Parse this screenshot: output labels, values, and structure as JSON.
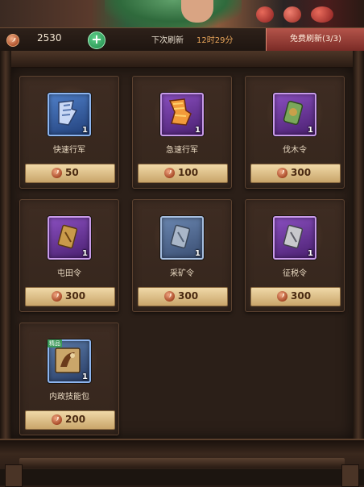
{
  "header": {
    "currency_value": "2530",
    "add_label": "+",
    "refresh_label": "下次刷新",
    "refresh_time": "12时29分",
    "free_refresh_label": "免费刷新(3/3)"
  },
  "colors": {
    "accent_gold": "#e9a65b",
    "price_bar": "#e2c48d",
    "rare_blue": "#4f7fc8",
    "epic_purple": "#8a4fc0",
    "free_button": "#b4544a"
  },
  "items": [
    {
      "name": "快速行军",
      "quantity": "1",
      "price": "50",
      "icon": "boot-wing-icon",
      "rarity": "blue"
    },
    {
      "name": "急速行军",
      "quantity": "1",
      "price": "100",
      "icon": "flaming-boot-icon",
      "rarity": "purple"
    },
    {
      "name": "伐木令",
      "quantity": "1",
      "price": "300",
      "icon": "wood-token-icon",
      "rarity": "purple"
    },
    {
      "name": "屯田令",
      "quantity": "1",
      "price": "300",
      "icon": "farm-token-icon",
      "rarity": "purple"
    },
    {
      "name": "采矿令",
      "quantity": "1",
      "price": "300",
      "icon": "mine-token-icon",
      "rarity": "blue"
    },
    {
      "name": "征税令",
      "quantity": "1",
      "price": "300",
      "icon": "tax-token-icon",
      "rarity": "purple"
    },
    {
      "name": "内政技能包",
      "quantity": "1",
      "price": "200",
      "icon": "skill-pack-icon",
      "rarity": "blue",
      "tag": "精品"
    }
  ]
}
